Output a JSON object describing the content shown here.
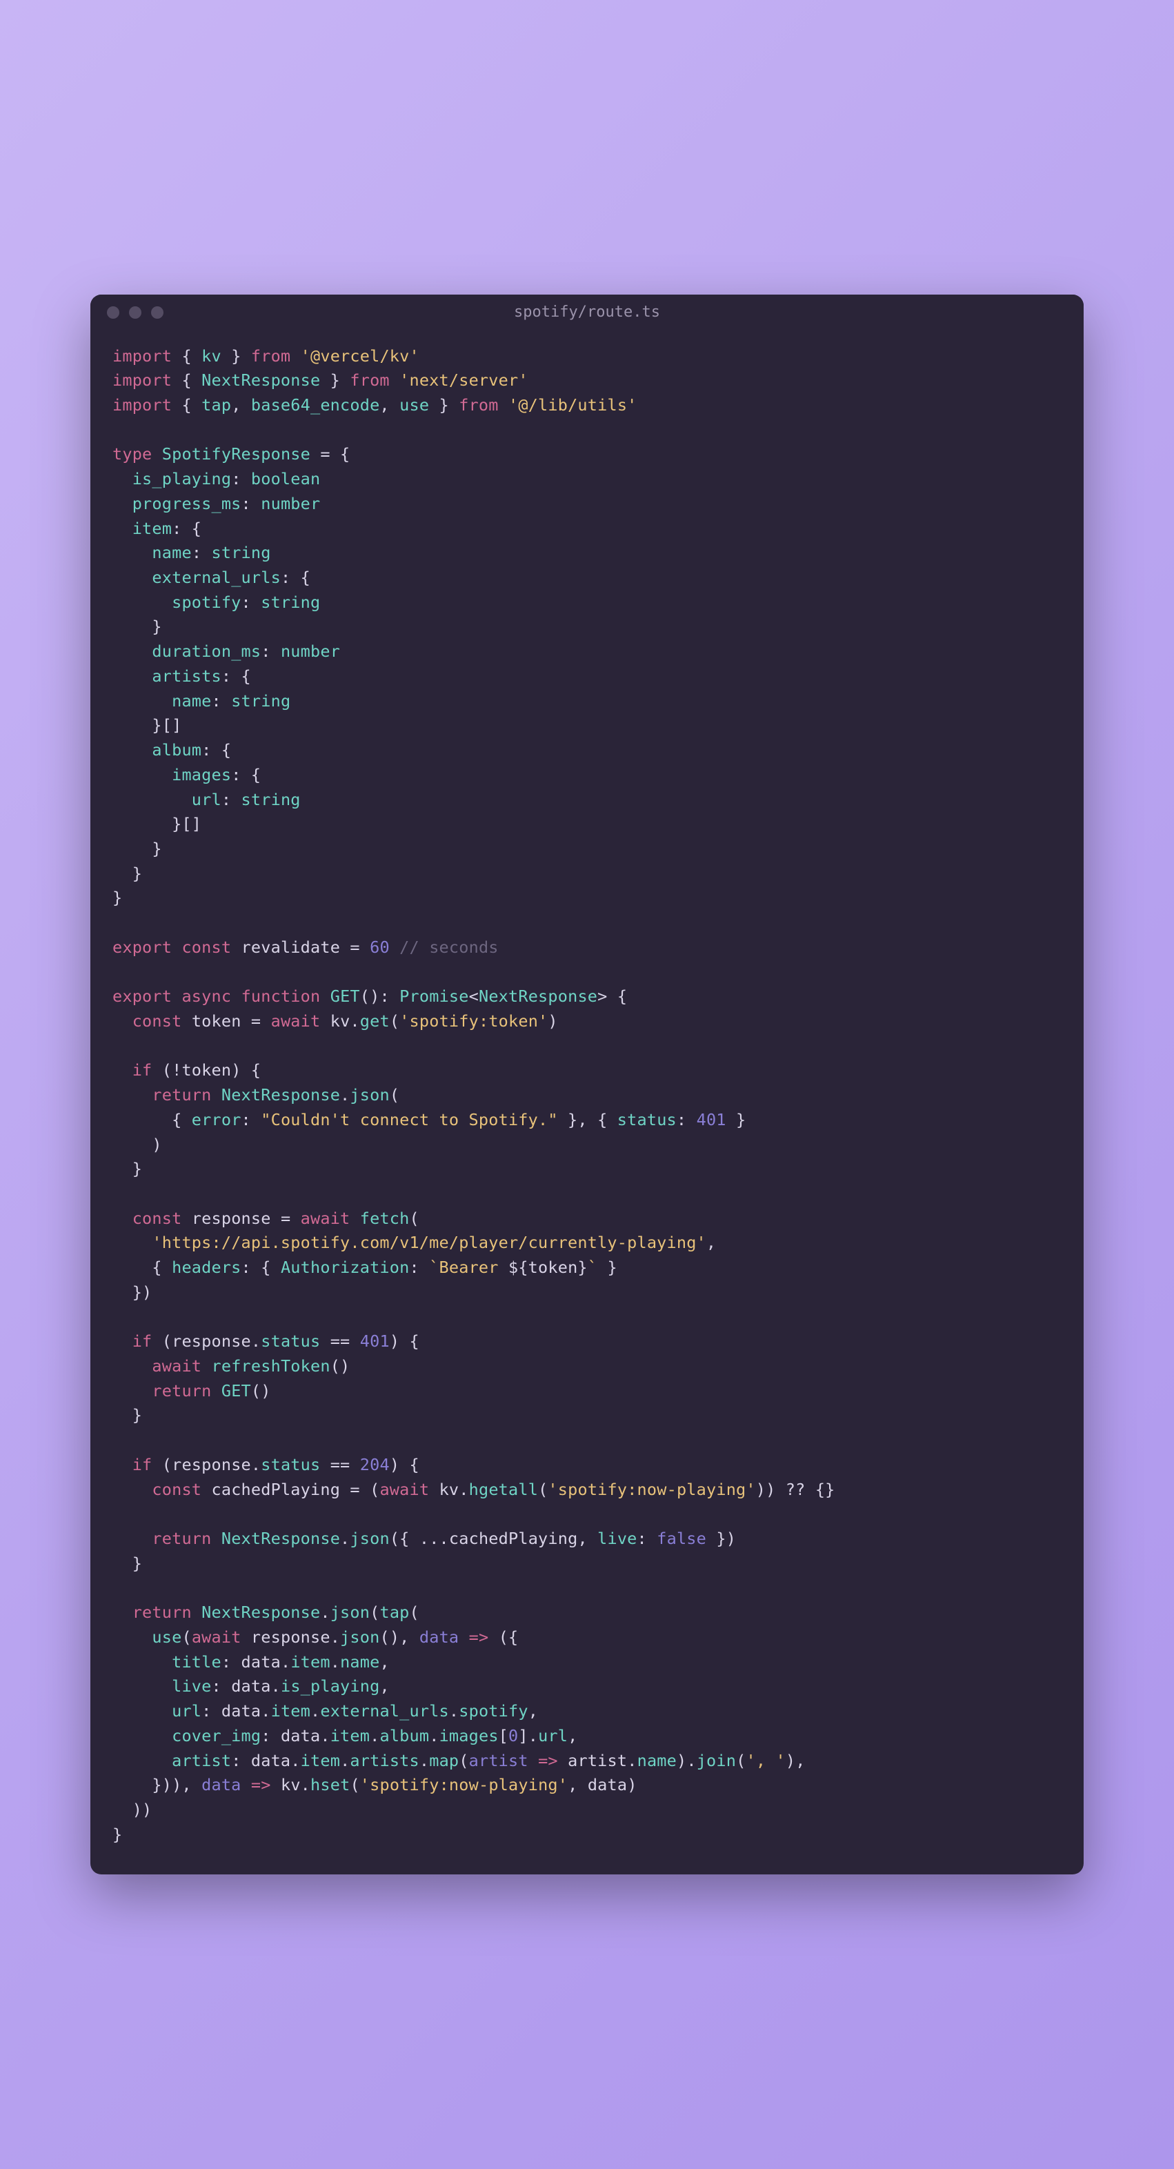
{
  "window": {
    "title": "spotify/route.ts"
  },
  "code": {
    "line1a": "import",
    "line1b": " { ",
    "line1c": "kv",
    "line1d": " } ",
    "line1e": "from",
    "line1f": " ",
    "line1g": "'@vercel/kv'",
    "line2a": "import",
    "line2b": " { ",
    "line2c": "NextResponse",
    "line2d": " } ",
    "line2e": "from",
    "line2f": " ",
    "line2g": "'next/server'",
    "line3a": "import",
    "line3b": " { ",
    "line3c": "tap",
    "line3d": ", ",
    "line3e": "base64_encode",
    "line3f": ", ",
    "line3g": "use",
    "line3h": " } ",
    "line3i": "from",
    "line3j": " ",
    "line3k": "'@/lib/utils'",
    "l5a": "type",
    "l5b": " ",
    "l5c": "SpotifyResponse",
    "l5d": " = {",
    "l6a": "  ",
    "l6b": "is_playing",
    "l6c": ": ",
    "l6d": "boolean",
    "l7a": "  ",
    "l7b": "progress_ms",
    "l7c": ": ",
    "l7d": "number",
    "l8a": "  ",
    "l8b": "item",
    "l8c": ": {",
    "l9a": "    ",
    "l9b": "name",
    "l9c": ": ",
    "l9d": "string",
    "l10a": "    ",
    "l10b": "external_urls",
    "l10c": ": {",
    "l11a": "      ",
    "l11b": "spotify",
    "l11c": ": ",
    "l11d": "string",
    "l12": "    }",
    "l13a": "    ",
    "l13b": "duration_ms",
    "l13c": ": ",
    "l13d": "number",
    "l14a": "    ",
    "l14b": "artists",
    "l14c": ": {",
    "l15a": "      ",
    "l15b": "name",
    "l15c": ": ",
    "l15d": "string",
    "l16": "    }[]",
    "l17a": "    ",
    "l17b": "album",
    "l17c": ": {",
    "l18a": "      ",
    "l18b": "images",
    "l18c": ": {",
    "l19a": "        ",
    "l19b": "url",
    "l19c": ": ",
    "l19d": "string",
    "l20": "      }[]",
    "l21": "    }",
    "l22": "  }",
    "l23": "}",
    "l25a": "export",
    "l25b": " ",
    "l25c": "const",
    "l25d": " ",
    "l25e": "revalidate",
    "l25f": " = ",
    "l25g": "60",
    "l25h": " ",
    "l25i": "// seconds",
    "l27a": "export",
    "l27b": " ",
    "l27c": "async",
    "l27d": " ",
    "l27e": "function",
    "l27f": " ",
    "l27g": "GET",
    "l27h": "(): ",
    "l27i": "Promise",
    "l27j": "<",
    "l27k": "NextResponse",
    "l27l": "> {",
    "l28a": "  ",
    "l28b": "const",
    "l28c": " ",
    "l28d": "token",
    "l28e": " = ",
    "l28f": "await",
    "l28g": " ",
    "l28h": "kv",
    "l28i": ".",
    "l28j": "get",
    "l28k": "(",
    "l28l": "'spotify:token'",
    "l28m": ")",
    "l30a": "  ",
    "l30b": "if",
    "l30c": " (!",
    "l30d": "token",
    "l30e": ") {",
    "l31a": "    ",
    "l31b": "return",
    "l31c": " ",
    "l31d": "NextResponse",
    "l31e": ".",
    "l31f": "json",
    "l31g": "(",
    "l32a": "      { ",
    "l32b": "error",
    "l32c": ": ",
    "l32d": "\"Couldn't connect to Spotify.\"",
    "l32e": " }, { ",
    "l32f": "status",
    "l32g": ": ",
    "l32h": "401",
    "l32i": " }",
    "l33": "    )",
    "l34": "  }",
    "l36a": "  ",
    "l36b": "const",
    "l36c": " ",
    "l36d": "response",
    "l36e": " = ",
    "l36f": "await",
    "l36g": " ",
    "l36h": "fetch",
    "l36i": "(",
    "l37a": "    ",
    "l37b": "'https://api.spotify.com/v1/me/player/currently-playing'",
    "l37c": ",",
    "l38a": "    { ",
    "l38b": "headers",
    "l38c": ": { ",
    "l38d": "Authorization",
    "l38e": ": ",
    "l38f": "`Bearer ",
    "l38g": "${",
    "l38h": "token",
    "l38i": "}",
    "l38j": "`",
    "l38k": " }",
    "l39": "  })",
    "l41a": "  ",
    "l41b": "if",
    "l41c": " (",
    "l41d": "response",
    "l41e": ".",
    "l41f": "status",
    "l41g": " == ",
    "l41h": "401",
    "l41i": ") {",
    "l42a": "    ",
    "l42b": "await",
    "l42c": " ",
    "l42d": "refreshToken",
    "l42e": "()",
    "l43a": "    ",
    "l43b": "return",
    "l43c": " ",
    "l43d": "GET",
    "l43e": "()",
    "l44": "  }",
    "l46a": "  ",
    "l46b": "if",
    "l46c": " (",
    "l46d": "response",
    "l46e": ".",
    "l46f": "status",
    "l46g": " == ",
    "l46h": "204",
    "l46i": ") {",
    "l47a": "    ",
    "l47b": "const",
    "l47c": " ",
    "l47d": "cachedPlaying",
    "l47e": " = (",
    "l47f": "await",
    "l47g": " ",
    "l47h": "kv",
    "l47i": ".",
    "l47j": "hgetall",
    "l47k": "(",
    "l47l": "'spotify:now-playing'",
    "l47m": ")) ?? {}",
    "l49a": "    ",
    "l49b": "return",
    "l49c": " ",
    "l49d": "NextResponse",
    "l49e": ".",
    "l49f": "json",
    "l49g": "({ ...",
    "l49h": "cachedPlaying",
    "l49i": ", ",
    "l49j": "live",
    "l49k": ": ",
    "l49l": "false",
    "l49m": " })",
    "l50": "  }",
    "l52a": "  ",
    "l52b": "return",
    "l52c": " ",
    "l52d": "NextResponse",
    "l52e": ".",
    "l52f": "json",
    "l52g": "(",
    "l52h": "tap",
    "l52i": "(",
    "l53a": "    ",
    "l53b": "use",
    "l53c": "(",
    "l53d": "await",
    "l53e": " ",
    "l53f": "response",
    "l53g": ".",
    "l53h": "json",
    "l53i": "(), ",
    "l53j": "data",
    "l53k": " ",
    "l53l": "=>",
    "l53m": " ({",
    "l54a": "      ",
    "l54b": "title",
    "l54c": ": ",
    "l54d": "data",
    "l54e": ".",
    "l54f": "item",
    "l54g": ".",
    "l54h": "name",
    "l54i": ",",
    "l55a": "      ",
    "l55b": "live",
    "l55c": ": ",
    "l55d": "data",
    "l55e": ".",
    "l55f": "is_playing",
    "l55g": ",",
    "l56a": "      ",
    "l56b": "url",
    "l56c": ": ",
    "l56d": "data",
    "l56e": ".",
    "l56f": "item",
    "l56g": ".",
    "l56h": "external_urls",
    "l56i": ".",
    "l56j": "spotify",
    "l56k": ",",
    "l57a": "      ",
    "l57b": "cover_img",
    "l57c": ": ",
    "l57d": "data",
    "l57e": ".",
    "l57f": "item",
    "l57g": ".",
    "l57h": "album",
    "l57i": ".",
    "l57j": "images",
    "l57k": "[",
    "l57l": "0",
    "l57m": "].",
    "l57n": "url",
    "l57o": ",",
    "l58a": "      ",
    "l58b": "artist",
    "l58c": ": ",
    "l58d": "data",
    "l58e": ".",
    "l58f": "item",
    "l58g": ".",
    "l58h": "artists",
    "l58i": ".",
    "l58j": "map",
    "l58k": "(",
    "l58l": "artist",
    "l58m": " ",
    "l58n": "=>",
    "l58o": " ",
    "l58p": "artist",
    "l58q": ".",
    "l58r": "name",
    "l58s": ").",
    "l58t": "join",
    "l58u": "(",
    "l58v": "', '",
    "l58w": "),",
    "l59a": "    })), ",
    "l59b": "data",
    "l59c": " ",
    "l59d": "=>",
    "l59e": " ",
    "l59f": "kv",
    "l59g": ".",
    "l59h": "hset",
    "l59i": "(",
    "l59j": "'spotify:now-playing'",
    "l59k": ", ",
    "l59l": "data",
    "l59m": ")",
    "l60": "  ))",
    "l61": "}"
  }
}
